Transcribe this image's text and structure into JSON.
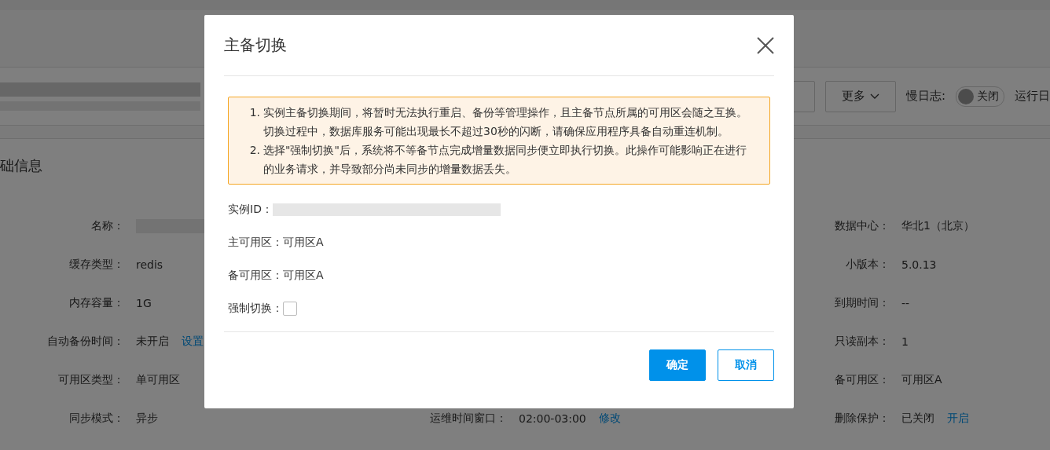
{
  "page": {
    "header": {
      "more_button": "更多",
      "slow_log_label": "慢日志:",
      "slow_log_toggle": {
        "label": "关闭",
        "on": false
      },
      "run_log_label": "运行日"
    },
    "section_title": "础信息",
    "rows": [
      {
        "left": {
          "label": "名称：",
          "kind": "redacted"
        },
        "right": {
          "label": "数据中心：",
          "value": "华北1（北京）",
          "kind": "text"
        }
      },
      {
        "left": {
          "label": "缓存类型：",
          "value": "redis",
          "kind": "text"
        },
        "right": {
          "label": "小版本：",
          "value": "5.0.13",
          "kind": "text"
        }
      },
      {
        "left": {
          "label": "内存容量：",
          "value": "1G",
          "kind": "text"
        },
        "right": {
          "label": "到期时间：",
          "value": "--",
          "kind": "text"
        }
      },
      {
        "left": {
          "label": "自动备份时间：",
          "value": "未开启",
          "link": "设置",
          "kind": "text"
        },
        "right": {
          "label": "只读副本：",
          "value": "1",
          "kind": "text"
        }
      },
      {
        "left": {
          "label": "可用区类型：",
          "value": "单可用区",
          "kind": "text"
        },
        "right": {
          "label": "备可用区：",
          "value": "可用区A",
          "kind": "text"
        }
      },
      {
        "left": {
          "label": "同步模式：",
          "value": "异步",
          "kind": "text"
        },
        "middle": {
          "label": "运维时间窗口：",
          "value": "02:00-03:00",
          "link": "修改",
          "kind": "text"
        },
        "right": {
          "label": "删除保护：",
          "value": "已关闭",
          "link": "开启",
          "kind": "text"
        }
      }
    ]
  },
  "dialog": {
    "title": "主备切换",
    "notices": [
      {
        "marker": "1.",
        "text": "实例主备切换期间，将暂时无法执行重启、备份等管理操作，且主备节点所属的可用区会随之互换。切换过程中，数据库服务可能出现最长不超过30秒的闪断，请确保应用程序具备自动重连机制。"
      },
      {
        "marker": "2.",
        "text": "选择\"强制切换\"后，系统将不等备节点完成增量数据同步便立即执行切换。此操作可能影响正在进行的业务请求，并导致部分尚未同步的增量数据丢失。"
      }
    ],
    "fields": [
      {
        "label": "实例ID：",
        "kind": "redacted"
      },
      {
        "label": "主可用区：",
        "value": "可用区A",
        "kind": "text"
      },
      {
        "label": "备可用区：",
        "value": "可用区A",
        "kind": "text"
      },
      {
        "label": "强制切换：",
        "kind": "checkbox",
        "checked": false
      }
    ],
    "buttons": [
      {
        "label": "确定",
        "kind": "primary"
      },
      {
        "label": "取消",
        "kind": "secondary"
      }
    ]
  }
}
